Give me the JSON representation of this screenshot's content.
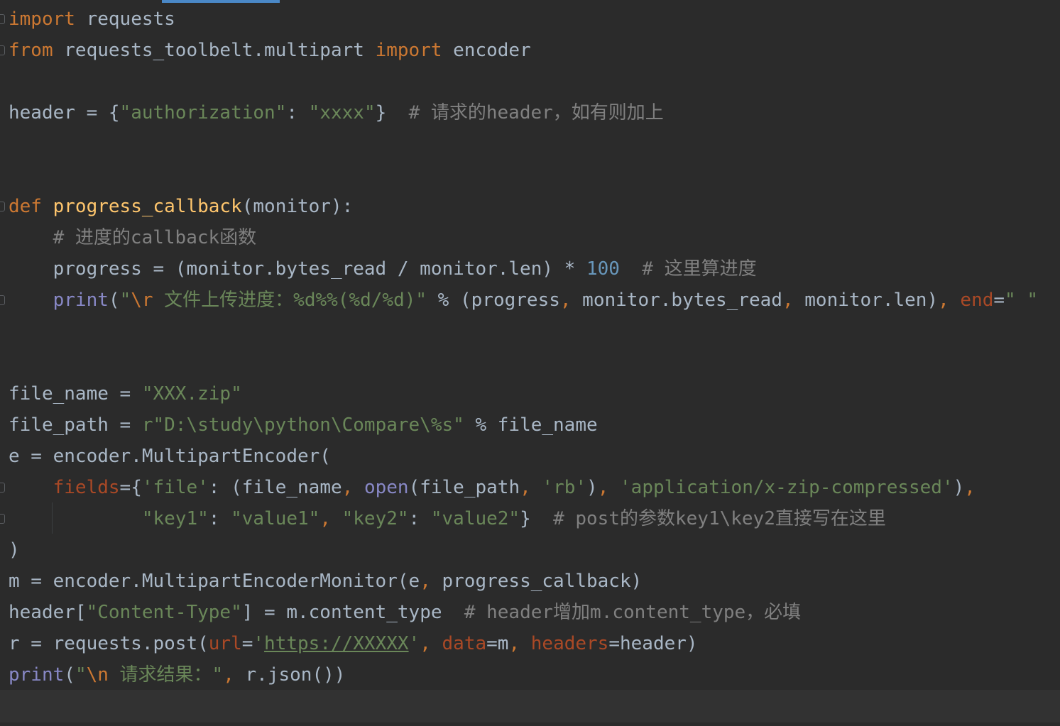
{
  "editor": {
    "lines": [
      {
        "parts": [
          {
            "t": "import",
            "c": "kw"
          },
          {
            "t": " requests",
            "c": ""
          }
        ]
      },
      {
        "parts": [
          {
            "t": "from",
            "c": "kw"
          },
          {
            "t": " requests_toolbelt.multipart ",
            "c": ""
          },
          {
            "t": "import",
            "c": "kw"
          },
          {
            "t": " encoder",
            "c": ""
          }
        ]
      },
      {
        "parts": []
      },
      {
        "parts": [
          {
            "t": "header = {",
            "c": ""
          },
          {
            "t": "\"authorization\"",
            "c": "st"
          },
          {
            "t": ": ",
            "c": ""
          },
          {
            "t": "\"xxxx\"",
            "c": "st"
          },
          {
            "t": "}  ",
            "c": ""
          },
          {
            "t": "# 请求的header，如有则加上",
            "c": "cm"
          }
        ]
      },
      {
        "parts": []
      },
      {
        "parts": []
      },
      {
        "parts": [
          {
            "t": "def",
            "c": "kw"
          },
          {
            "t": " ",
            "c": ""
          },
          {
            "t": "progress_callback",
            "c": "fn"
          },
          {
            "t": "(monitor):",
            "c": ""
          }
        ]
      },
      {
        "parts": [
          {
            "t": "    ",
            "c": ""
          },
          {
            "t": "# 进度的callback函数",
            "c": "cm"
          }
        ]
      },
      {
        "parts": [
          {
            "t": "    progress = (monitor.bytes_read / monitor.len) * ",
            "c": ""
          },
          {
            "t": "100",
            "c": "nu"
          },
          {
            "t": "  ",
            "c": ""
          },
          {
            "t": "# 这里算进度",
            "c": "cm"
          }
        ]
      },
      {
        "parts": [
          {
            "t": "    ",
            "c": ""
          },
          {
            "t": "print",
            "c": "bi"
          },
          {
            "t": "(",
            "c": ""
          },
          {
            "t": "\"",
            "c": "st"
          },
          {
            "t": "\\r",
            "c": "esc"
          },
          {
            "t": " 文件上传进度：%d%%(%d/%d)\"",
            "c": "st"
          },
          {
            "t": " % (progress",
            "c": ""
          },
          {
            "t": ",",
            "c": "pu"
          },
          {
            "t": " monitor.bytes_read",
            "c": ""
          },
          {
            "t": ",",
            "c": "pu"
          },
          {
            "t": " monitor.len)",
            "c": ""
          },
          {
            "t": ",",
            "c": "pu"
          },
          {
            "t": " ",
            "c": ""
          },
          {
            "t": "end",
            "c": "pm"
          },
          {
            "t": "=",
            "c": ""
          },
          {
            "t": "\" \"",
            "c": "st"
          }
        ]
      },
      {
        "parts": []
      },
      {
        "parts": []
      },
      {
        "parts": [
          {
            "t": "file_name = ",
            "c": ""
          },
          {
            "t": "\"XXX.zip\"",
            "c": "st"
          }
        ]
      },
      {
        "parts": [
          {
            "t": "file_path = ",
            "c": ""
          },
          {
            "t": "r\"D:\\study\\python\\Compare\\%s\"",
            "c": "st"
          },
          {
            "t": " % file_name",
            "c": ""
          }
        ]
      },
      {
        "parts": [
          {
            "t": "e = encoder.MultipartEncoder(",
            "c": ""
          }
        ]
      },
      {
        "parts": [
          {
            "t": "    ",
            "c": ""
          },
          {
            "t": "fields",
            "c": "pm"
          },
          {
            "t": "={",
            "c": ""
          },
          {
            "t": "'file'",
            "c": "st"
          },
          {
            "t": ": (file_name",
            "c": ""
          },
          {
            "t": ",",
            "c": "pu"
          },
          {
            "t": " ",
            "c": ""
          },
          {
            "t": "open",
            "c": "bi"
          },
          {
            "t": "(file_path",
            "c": ""
          },
          {
            "t": ",",
            "c": "pu"
          },
          {
            "t": " ",
            "c": ""
          },
          {
            "t": "'rb'",
            "c": "st"
          },
          {
            "t": ")",
            "c": ""
          },
          {
            "t": ",",
            "c": "pu"
          },
          {
            "t": " ",
            "c": ""
          },
          {
            "t": "'application/x-zip-compressed'",
            "c": "st"
          },
          {
            "t": ")",
            "c": ""
          },
          {
            "t": ",",
            "c": "pu"
          }
        ]
      },
      {
        "parts": [
          {
            "t": "            ",
            "c": ""
          },
          {
            "t": "\"key1\"",
            "c": "st"
          },
          {
            "t": ": ",
            "c": ""
          },
          {
            "t": "\"value1\"",
            "c": "st"
          },
          {
            "t": ",",
            "c": "pu"
          },
          {
            "t": " ",
            "c": ""
          },
          {
            "t": "\"key2\"",
            "c": "st"
          },
          {
            "t": ": ",
            "c": ""
          },
          {
            "t": "\"value2\"",
            "c": "st"
          },
          {
            "t": "}  ",
            "c": ""
          },
          {
            "t": "# post的参数key1\\key2直接写在这里",
            "c": "cm"
          }
        ]
      },
      {
        "parts": [
          {
            "t": ")",
            "c": ""
          }
        ]
      },
      {
        "parts": [
          {
            "t": "m = encoder.MultipartEncoderMonitor(e",
            "c": ""
          },
          {
            "t": ",",
            "c": "pu"
          },
          {
            "t": " progress_callback)",
            "c": ""
          }
        ]
      },
      {
        "parts": [
          {
            "t": "header[",
            "c": ""
          },
          {
            "t": "\"Content-Type\"",
            "c": "st"
          },
          {
            "t": "] = m.content_type  ",
            "c": ""
          },
          {
            "t": "# header增加m.content_type，必填",
            "c": "cm"
          }
        ]
      },
      {
        "parts": [
          {
            "t": "r = requests.post(",
            "c": ""
          },
          {
            "t": "url",
            "c": "pm"
          },
          {
            "t": "=",
            "c": ""
          },
          {
            "t": "'",
            "c": "st"
          },
          {
            "t": "https://XXXXX",
            "c": "st ul"
          },
          {
            "t": "'",
            "c": "st"
          },
          {
            "t": ",",
            "c": "pu"
          },
          {
            "t": " ",
            "c": ""
          },
          {
            "t": "data",
            "c": "pm"
          },
          {
            "t": "=m",
            "c": ""
          },
          {
            "t": ",",
            "c": "pu"
          },
          {
            "t": " ",
            "c": ""
          },
          {
            "t": "headers",
            "c": "pm"
          },
          {
            "t": "=header)",
            "c": ""
          }
        ]
      },
      {
        "parts": [
          {
            "t": "print",
            "c": "bi"
          },
          {
            "t": "(",
            "c": ""
          },
          {
            "t": "\"",
            "c": "st"
          },
          {
            "t": "\\n",
            "c": "esc"
          },
          {
            "t": " 请求结果：\"",
            "c": "st"
          },
          {
            "t": ",",
            "c": "pu"
          },
          {
            "t": " r.json())",
            "c": ""
          }
        ]
      }
    ]
  }
}
